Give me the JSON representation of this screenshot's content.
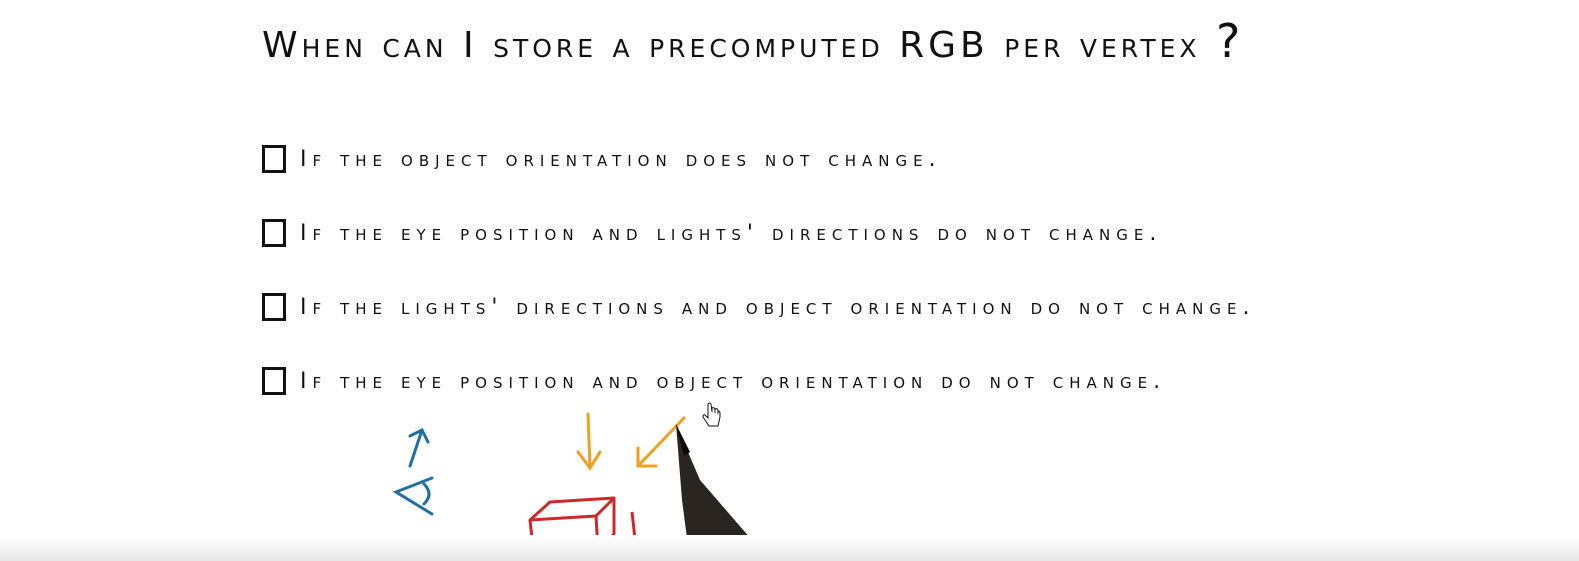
{
  "quiz": {
    "title": "When can I store a precomputed RGB per vertex",
    "title_mark": "?",
    "options": [
      {
        "label": "If the object orientation does not change."
      },
      {
        "label": "If the eye position and lights' directions do not change."
      },
      {
        "label": "If the lights' directions and object orientation do not change."
      },
      {
        "label": "If the eye position and object orientation do not change."
      }
    ]
  },
  "colors": {
    "ink": "#111111",
    "eye_blue": "#1f6fa3",
    "light_orange": "#f0a020",
    "box_red": "#cc2a2a",
    "pen": "#2a2520"
  },
  "icons": [
    "eye-sketch-icon",
    "light-arrow-icon",
    "box-sketch-icon",
    "pen-icon",
    "hand-cursor-icon"
  ]
}
